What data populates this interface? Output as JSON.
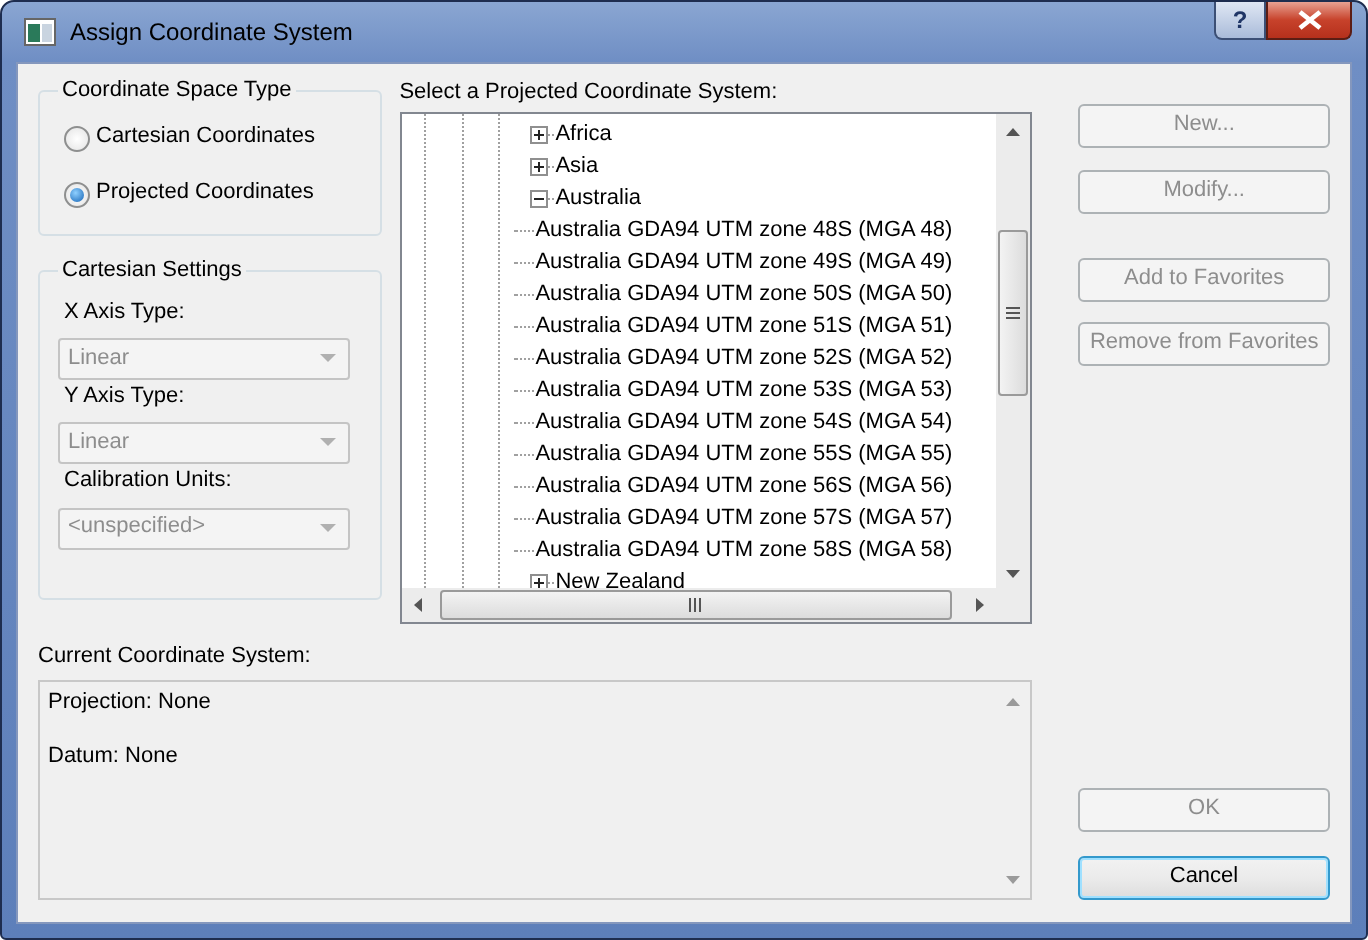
{
  "window": {
    "title": "Assign Coordinate System",
    "help_button": "?"
  },
  "space_type": {
    "title": "Coordinate Space Type",
    "options": [
      {
        "label": "Cartesian Coordinates",
        "selected": false
      },
      {
        "label": "Projected Coordinates",
        "selected": true
      }
    ]
  },
  "cartesian_settings": {
    "title": "Cartesian Settings",
    "fields": [
      {
        "label": "X Axis Type:",
        "value": "Linear",
        "disabled": true
      },
      {
        "label": "Y Axis Type:",
        "value": "Linear",
        "disabled": true
      },
      {
        "label": "Calibration Units:",
        "value": "<unspecified>",
        "disabled": true
      }
    ]
  },
  "tree": {
    "label": "Select a Projected Coordinate System:",
    "items": [
      {
        "label": "Africa",
        "expanded": false
      },
      {
        "label": "Asia",
        "expanded": false
      },
      {
        "label": "Australia",
        "expanded": true,
        "children": [
          {
            "label": "Australia GDA94 UTM zone 48S (MGA 48)"
          },
          {
            "label": "Australia GDA94 UTM zone 49S (MGA 49)"
          },
          {
            "label": "Australia GDA94 UTM zone 50S (MGA 50)"
          },
          {
            "label": "Australia GDA94 UTM zone 51S (MGA 51)"
          },
          {
            "label": "Australia GDA94 UTM zone 52S (MGA 52)"
          },
          {
            "label": "Australia GDA94 UTM zone 53S (MGA 53)"
          },
          {
            "label": "Australia GDA94 UTM zone 54S (MGA 54)"
          },
          {
            "label": "Australia GDA94 UTM zone 55S (MGA 55)"
          },
          {
            "label": "Australia GDA94 UTM zone 56S (MGA 56)"
          },
          {
            "label": "Australia GDA94 UTM zone 57S (MGA 57)"
          },
          {
            "label": "Australia GDA94 UTM zone 58S (MGA 58)"
          }
        ]
      },
      {
        "label": "New Zealand",
        "expanded": false
      }
    ]
  },
  "side_buttons": [
    {
      "label": "New...",
      "disabled": true
    },
    {
      "label": "Modify...",
      "disabled": true
    },
    {
      "label": "Add to Favorites",
      "disabled": true
    },
    {
      "label": "Remove from Favorites",
      "disabled": true
    }
  ],
  "current": {
    "label": "Current Coordinate System:",
    "lines": [
      "Projection: None",
      "Datum: None"
    ]
  },
  "dialog_buttons": [
    {
      "label": "OK",
      "disabled": true,
      "default": false
    },
    {
      "label": "Cancel",
      "disabled": false,
      "default": true
    }
  ]
}
